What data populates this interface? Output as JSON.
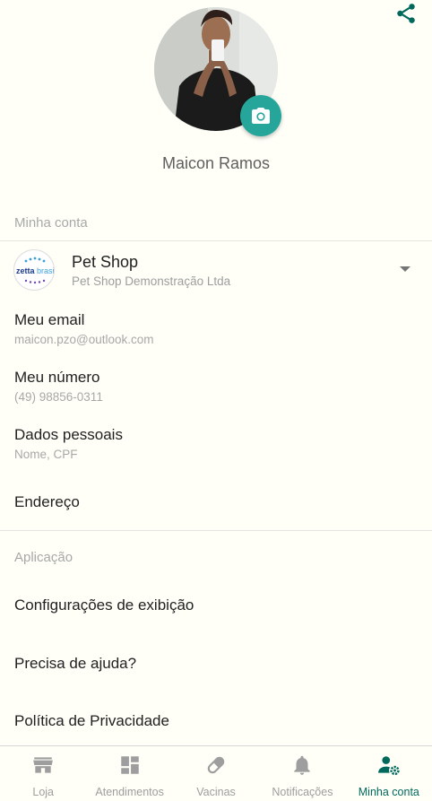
{
  "profile": {
    "name": "Maicon Ramos"
  },
  "account_section": {
    "title": "Minha conta",
    "company": {
      "name": "Pet Shop",
      "subtitle": "Pet Shop Demonstração Ltda",
      "logo_text": "zettabrasil"
    },
    "items": [
      {
        "title": "Meu email",
        "value": "maicon.pzo@outlook.com"
      },
      {
        "title": "Meu número",
        "value": "(49) 98856-0311"
      },
      {
        "title": "Dados pessoais",
        "value": "Nome, CPF"
      },
      {
        "title": "Endereço"
      }
    ]
  },
  "app_section": {
    "title": "Aplicação",
    "items": [
      {
        "title": "Configurações de exibição"
      },
      {
        "title": "Precisa de ajuda?"
      },
      {
        "title": "Política de Privacidade"
      }
    ]
  },
  "bottom_nav": {
    "items": [
      {
        "label": "Loja",
        "icon": "store-icon"
      },
      {
        "label": "Atendimentos",
        "icon": "dashboard-icon"
      },
      {
        "label": "Vacinas",
        "icon": "pill-icon"
      },
      {
        "label": "Notificações",
        "icon": "bell-icon"
      },
      {
        "label": "Minha conta",
        "icon": "account-settings-icon"
      }
    ],
    "active_index": 4
  },
  "colors": {
    "accent": "#26a69a",
    "active_nav": "#00695c",
    "share_icon": "#00695c",
    "background": "#fffff8"
  }
}
